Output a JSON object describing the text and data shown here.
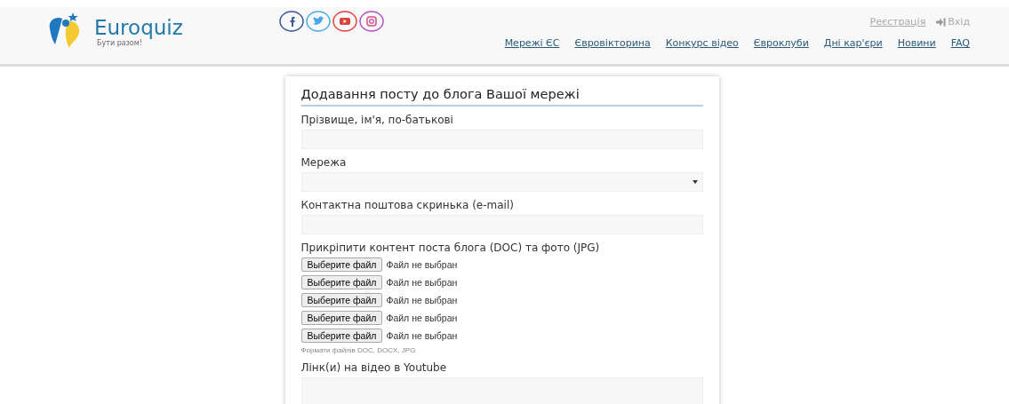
{
  "logo": {
    "name": "Euroquiz",
    "tagline": "Бути разом!"
  },
  "account_links": [
    {
      "label": "Реєстрація",
      "kind": "plain"
    },
    {
      "label": "Вхід",
      "kind": "login"
    }
  ],
  "nav": [
    "Мережі ЄС",
    "Євровікторина",
    "Конкурс відео",
    "Євроклуби",
    "Дні кар'єри",
    "Новини",
    "FAQ"
  ],
  "form": {
    "title": "Додавання посту до блога Вашої мережі",
    "fields": [
      {
        "kind": "text",
        "label": "Прізвище, ім'я, по-батькові"
      },
      {
        "kind": "select",
        "label": "Мережа"
      },
      {
        "kind": "text",
        "label": "Контактна поштова скринька (e-mail)"
      },
      {
        "kind": "files",
        "label": "Прикріпити контент поста блога (DOC) та фото (JPG)",
        "files": [
          {
            "button": "Выберите файл",
            "status": "Файл не выбран"
          },
          {
            "button": "Выберите файл",
            "status": "Файл не выбран"
          },
          {
            "button": "Выберите файл",
            "status": "Файл не выбран"
          },
          {
            "button": "Выберите файл",
            "status": "Файл не выбран"
          },
          {
            "button": "Выберите файл",
            "status": "Файл не выбран"
          }
        ],
        "hint": "Формати файлів DOC, DOCX, JPG"
      },
      {
        "kind": "textarea",
        "label": "Лінк(и) на відео в Youtube"
      }
    ]
  }
}
